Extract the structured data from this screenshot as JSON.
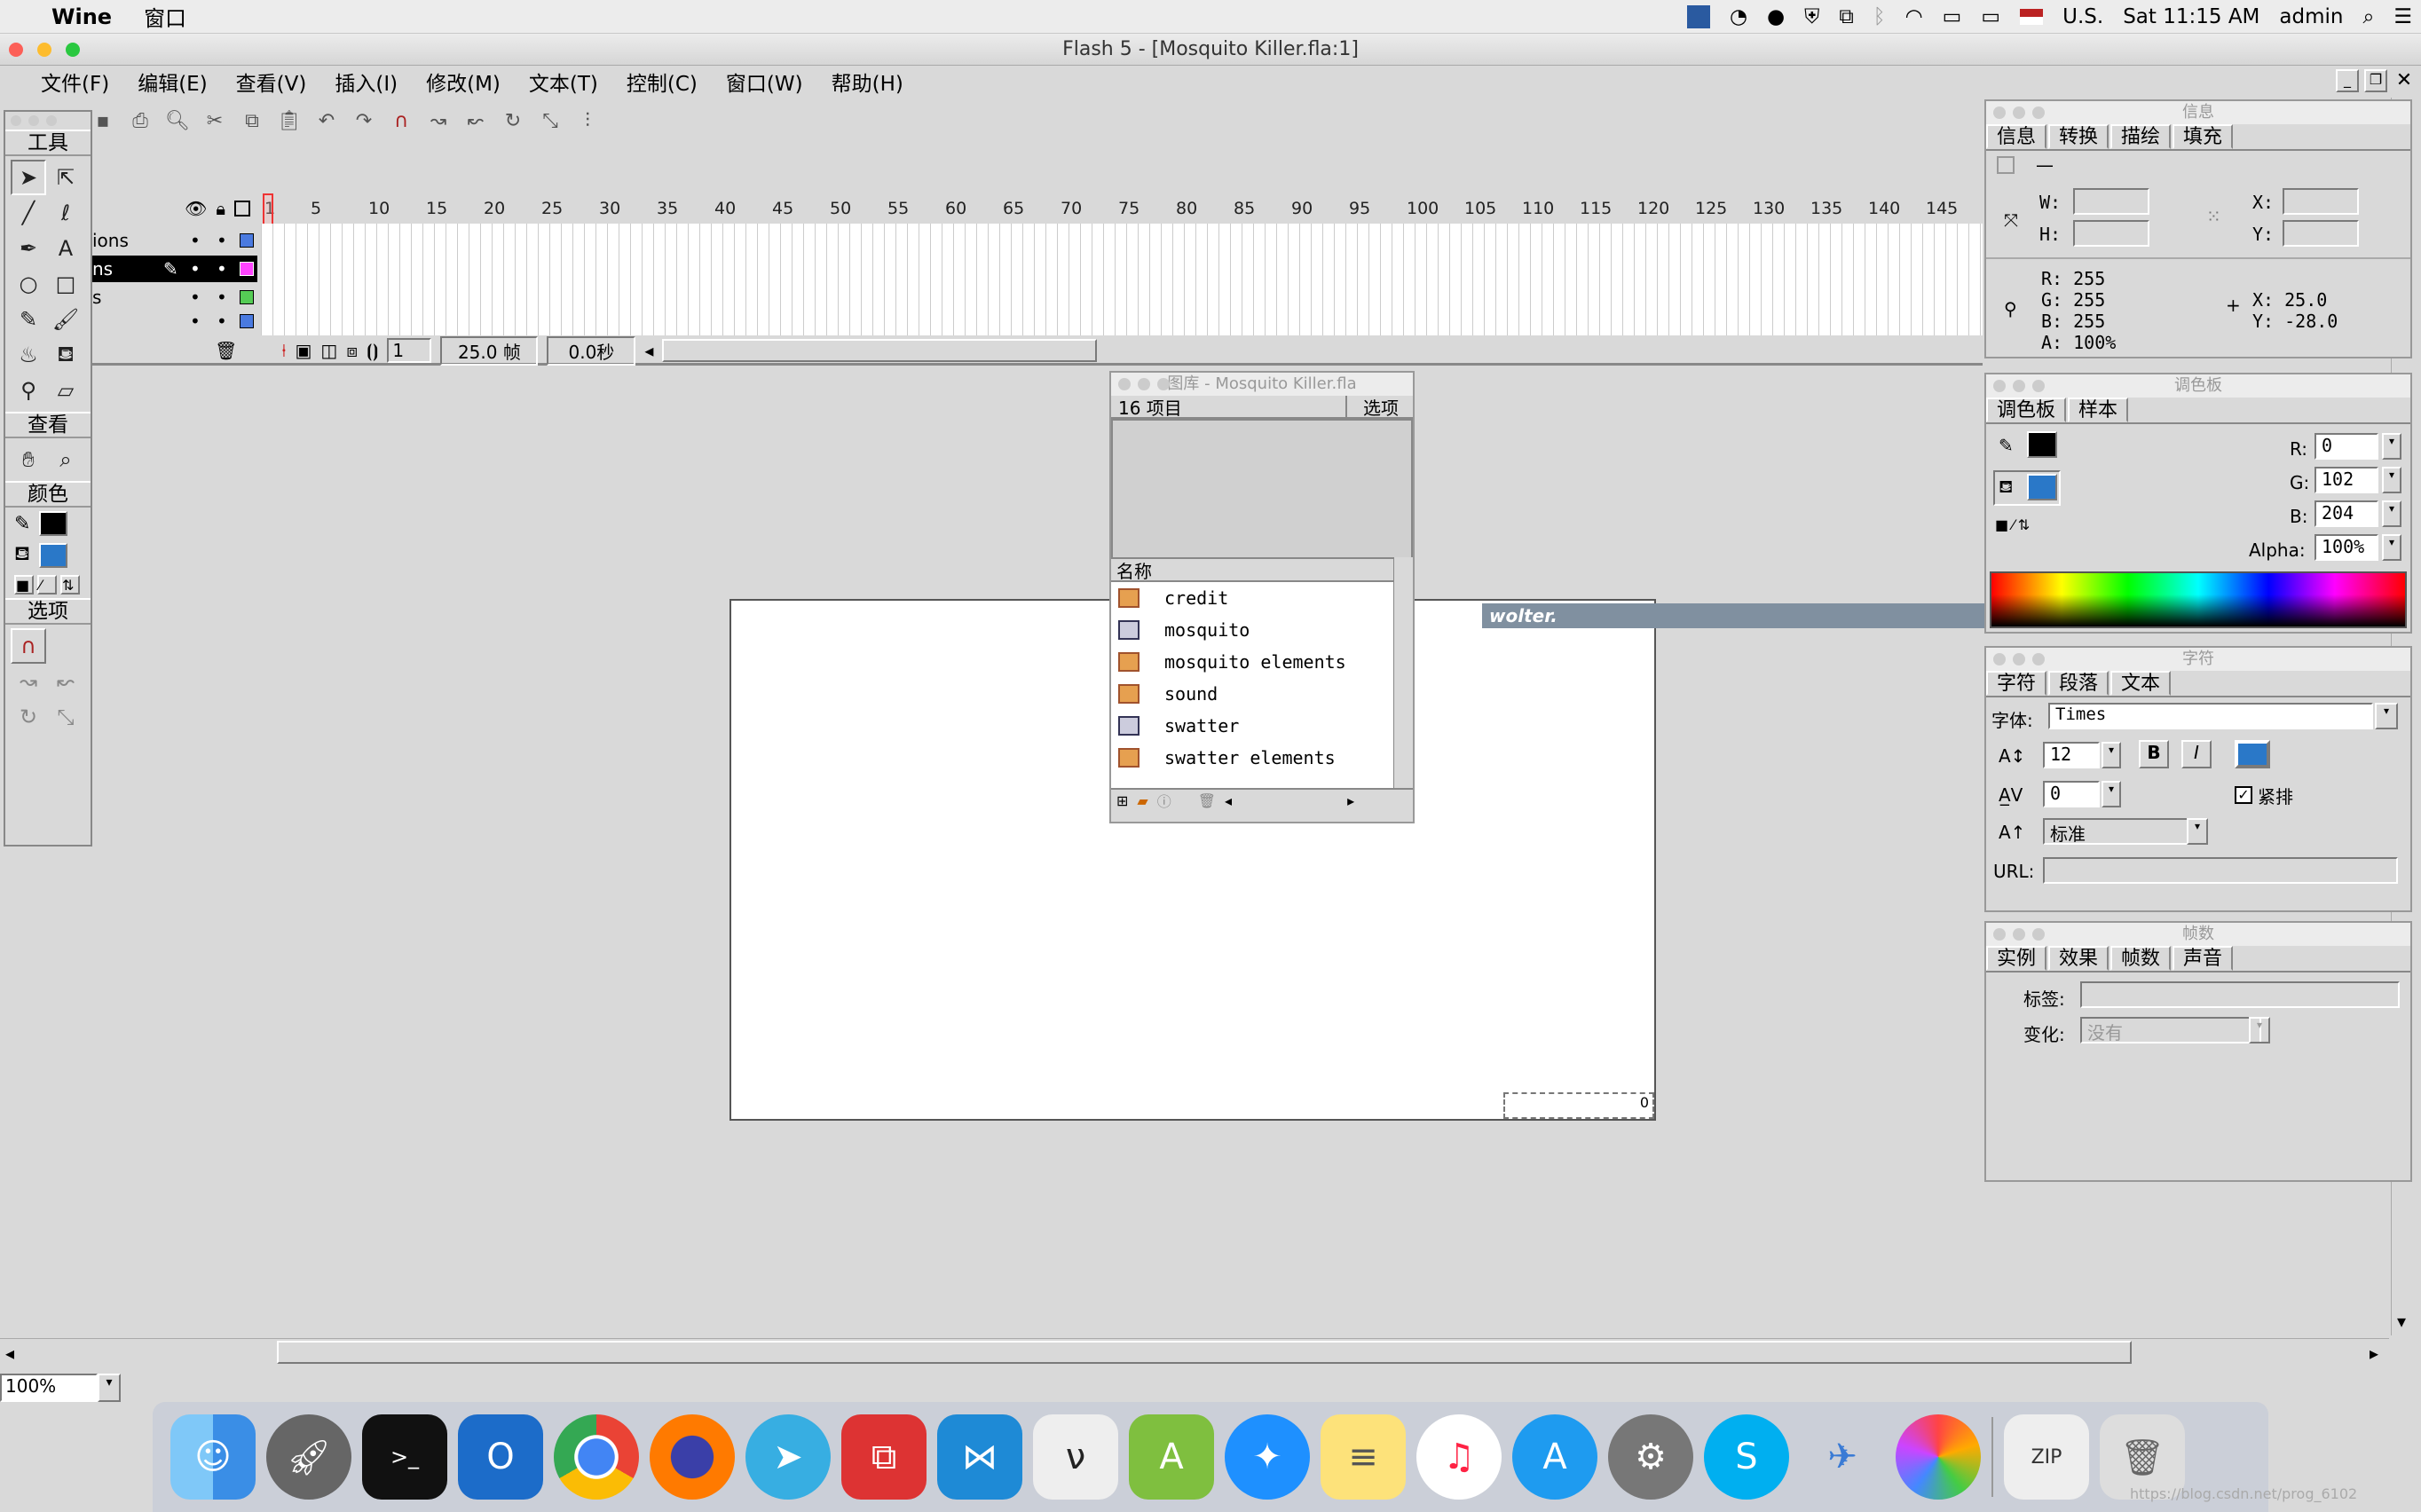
{
  "menubar": {
    "apple": "",
    "app": "Wine",
    "window_menu": "窗口",
    "input": "U.S.",
    "clock": "Sat 11:15 AM",
    "user": "admin"
  },
  "window": {
    "title": "Flash 5 - [Mosquito Killer.fla:1]"
  },
  "app_menu": [
    "文件(F)",
    "编辑(E)",
    "查看(V)",
    "插入(I)",
    "修改(M)",
    "文本(T)",
    "控制(C)",
    "窗口(W)",
    "帮助(H)"
  ],
  "scene": {
    "label": "1"
  },
  "tools": {
    "section_tools": "工具",
    "section_view": "查看",
    "section_colors": "颜色",
    "section_options": "选项"
  },
  "timeline": {
    "ruler": [
      "1",
      "5",
      "10",
      "15",
      "20",
      "25",
      "30",
      "35",
      "40",
      "45",
      "50",
      "55",
      "60",
      "65",
      "70",
      "75",
      "80",
      "85",
      "90",
      "95",
      "100",
      "105",
      "110",
      "115",
      "120",
      "125",
      "130",
      "135",
      "140",
      "145"
    ],
    "layers": [
      {
        "name": "ions"
      },
      {
        "name": "ns"
      },
      {
        "name": "s"
      },
      {
        "name": ""
      }
    ],
    "current_frame": "1",
    "fps": "25.0 帧",
    "elapsed": "0.0秒"
  },
  "library": {
    "title": "图库 - Mosquito Killer.fla",
    "count": "16 项目",
    "options": "选项",
    "col_name": "名称",
    "items": [
      {
        "name": "credit",
        "type": "folder"
      },
      {
        "name": "mosquito",
        "type": "symbol"
      },
      {
        "name": "mosquito elements",
        "type": "folder"
      },
      {
        "name": "sound",
        "type": "folder"
      },
      {
        "name": "swatter",
        "type": "symbol"
      },
      {
        "name": "swatter elements",
        "type": "folder"
      }
    ]
  },
  "stage": {
    "overlay_text": "wolter.",
    "corner_label": "0"
  },
  "info_panel": {
    "title": "信息",
    "tabs": [
      "信息",
      "转换",
      "描绘",
      "填充"
    ],
    "w_label": "W:",
    "h_label": "H:",
    "x_label": "X:",
    "y_label": "Y:",
    "color_r": "R: 255",
    "color_g": "G: 255",
    "color_b": "B: 255",
    "color_a": "A: 100%",
    "cursor_x": "X: 25.0",
    "cursor_y": "Y: -28.0",
    "dash": "—"
  },
  "mixer_panel": {
    "title": "调色板",
    "tabs": [
      "调色板",
      "样本"
    ],
    "r_label": "R:",
    "r": "0",
    "g_label": "G:",
    "g": "102",
    "b_label": "B:",
    "b": "204",
    "alpha_label": "Alpha:",
    "alpha": "100%",
    "stroke_color": "#000000",
    "fill_color": "#0066cc"
  },
  "char_panel": {
    "title": "字符",
    "tabs": [
      "字符",
      "段落",
      "文本"
    ],
    "font_label": "字体:",
    "font": "Times",
    "size": "12",
    "tracking": "0",
    "kerning_label": "紧排",
    "baseline": "标准",
    "url_label": "URL:",
    "bold": "B",
    "italic": "I"
  },
  "frame_panel": {
    "title": "帧数",
    "tabs": [
      "实例",
      "效果",
      "帧数",
      "声音"
    ],
    "label_label": "标签:",
    "tween_label": "变化:",
    "tween": "没有"
  },
  "zoom": {
    "value": "100%"
  },
  "dock": {
    "apps": [
      "Finder",
      "Launchpad",
      "Terminal",
      "Outlook",
      "Chrome",
      "Firefox",
      "Telegram",
      "Parallels",
      "VS Code",
      "Eudic",
      "Android Studio",
      "Safari",
      "Notes",
      "iTunes",
      "App Store",
      "System Preferences",
      "Skype",
      "Lite",
      "Aperture",
      "ZIP",
      "Trash"
    ]
  },
  "watermark": "https://blog.csdn.net/prog_6102"
}
